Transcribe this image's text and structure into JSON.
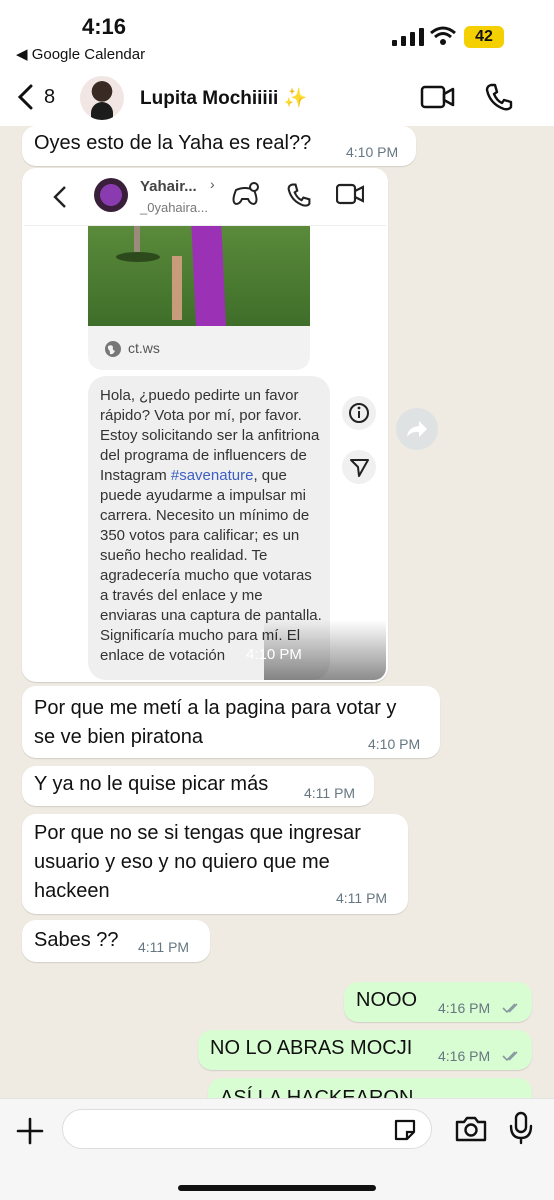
{
  "status": {
    "time": "4:16",
    "back_app": "◀ Google Calendar",
    "battery": "42"
  },
  "header": {
    "back_count": "8",
    "contact_name": "Lupita Mochiiiii ✨"
  },
  "messages": [
    {
      "dir": "in",
      "text": "Oyes esto de la Yaha es real??",
      "time": "4:10 PM"
    },
    {
      "dir": "in",
      "type": "screenshot",
      "time": "4:10 PM"
    },
    {
      "dir": "in",
      "text": "Por que me metí a la pagina para votar y\nse ve bien piratona",
      "time": "4:10 PM"
    },
    {
      "dir": "in",
      "text": "Y ya no le quise picar más",
      "time": "4:11 PM"
    },
    {
      "dir": "in",
      "text": "Por que no se si tengas que ingresar\nusuario y eso y no quiero que me\nhackeen",
      "time": "4:11 PM"
    },
    {
      "dir": "in",
      "text": "Sabes ??",
      "time": "4:11 PM"
    },
    {
      "dir": "out",
      "text": "NOOO",
      "time": "4:16 PM"
    },
    {
      "dir": "out",
      "text": "NO LO ABRAS MOCJI",
      "time": "4:16 PM"
    },
    {
      "dir": "out",
      "text": "ASÍ LA HACKEARON",
      "time": ""
    }
  ],
  "screenshot": {
    "profile_name": "Yahair...",
    "profile_handle": "_0yahaira...",
    "link_domain": "ct.ws",
    "message_before_tag": "Hola, ¿puedo pedirte un favor rápido? Vota por mí, por favor. Estoy solicitando ser la anfitriona del programa de influencers de Instagram ",
    "hashtag": "#savenature",
    "message_after_tag": ", que puede ayudarme a impulsar mi carrera. Necesito un mínimo de 350 votos para calificar; es un sueño hecho realidad. Te agradecería mucho que votaras a través del enlace y me enviaras una captura de pantalla. Significaría mucho para mí. El enlace de votación",
    "time": "4:10 PM"
  },
  "composer": {
    "placeholder": ""
  },
  "colors": {
    "chat_bg": "#efeae2",
    "incoming": "#ffffff",
    "outgoing": "#d9fdd3",
    "read_ticks": "#53bdeb"
  }
}
